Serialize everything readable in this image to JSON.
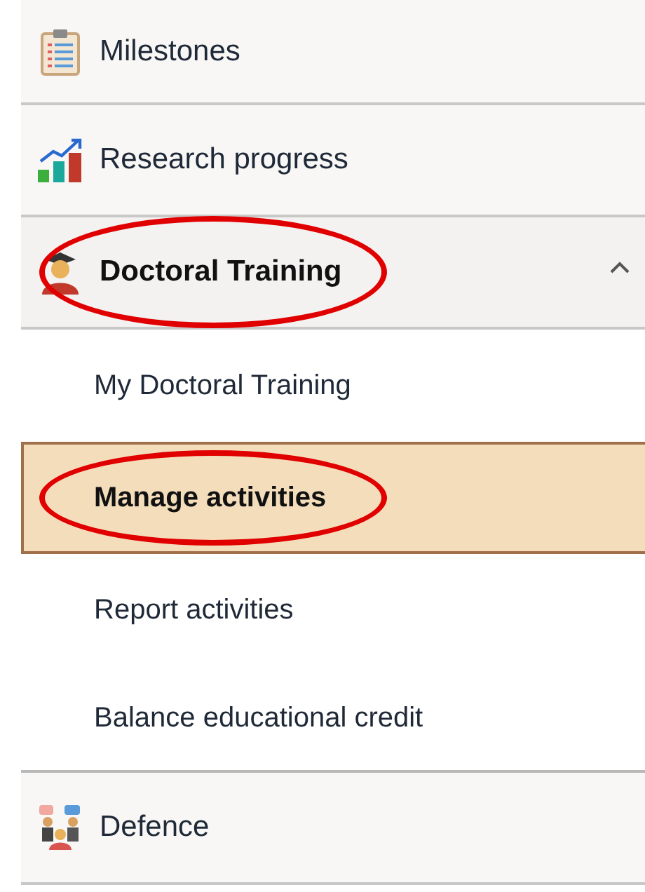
{
  "menu": {
    "items": [
      {
        "label": "Milestones",
        "circled": false
      },
      {
        "label": "Research progress",
        "circled": false
      },
      {
        "label": "Doctoral Training",
        "circled": true,
        "expanded": true,
        "children": [
          {
            "label": "My Doctoral Training",
            "selected": false,
            "circled": false
          },
          {
            "label": "Manage activities",
            "selected": true,
            "circled": true
          },
          {
            "label": "Report activities",
            "selected": false,
            "circled": false
          },
          {
            "label": "Balance educational credit",
            "selected": false,
            "circled": false
          }
        ]
      },
      {
        "label": "Defence",
        "circled": false
      }
    ]
  }
}
